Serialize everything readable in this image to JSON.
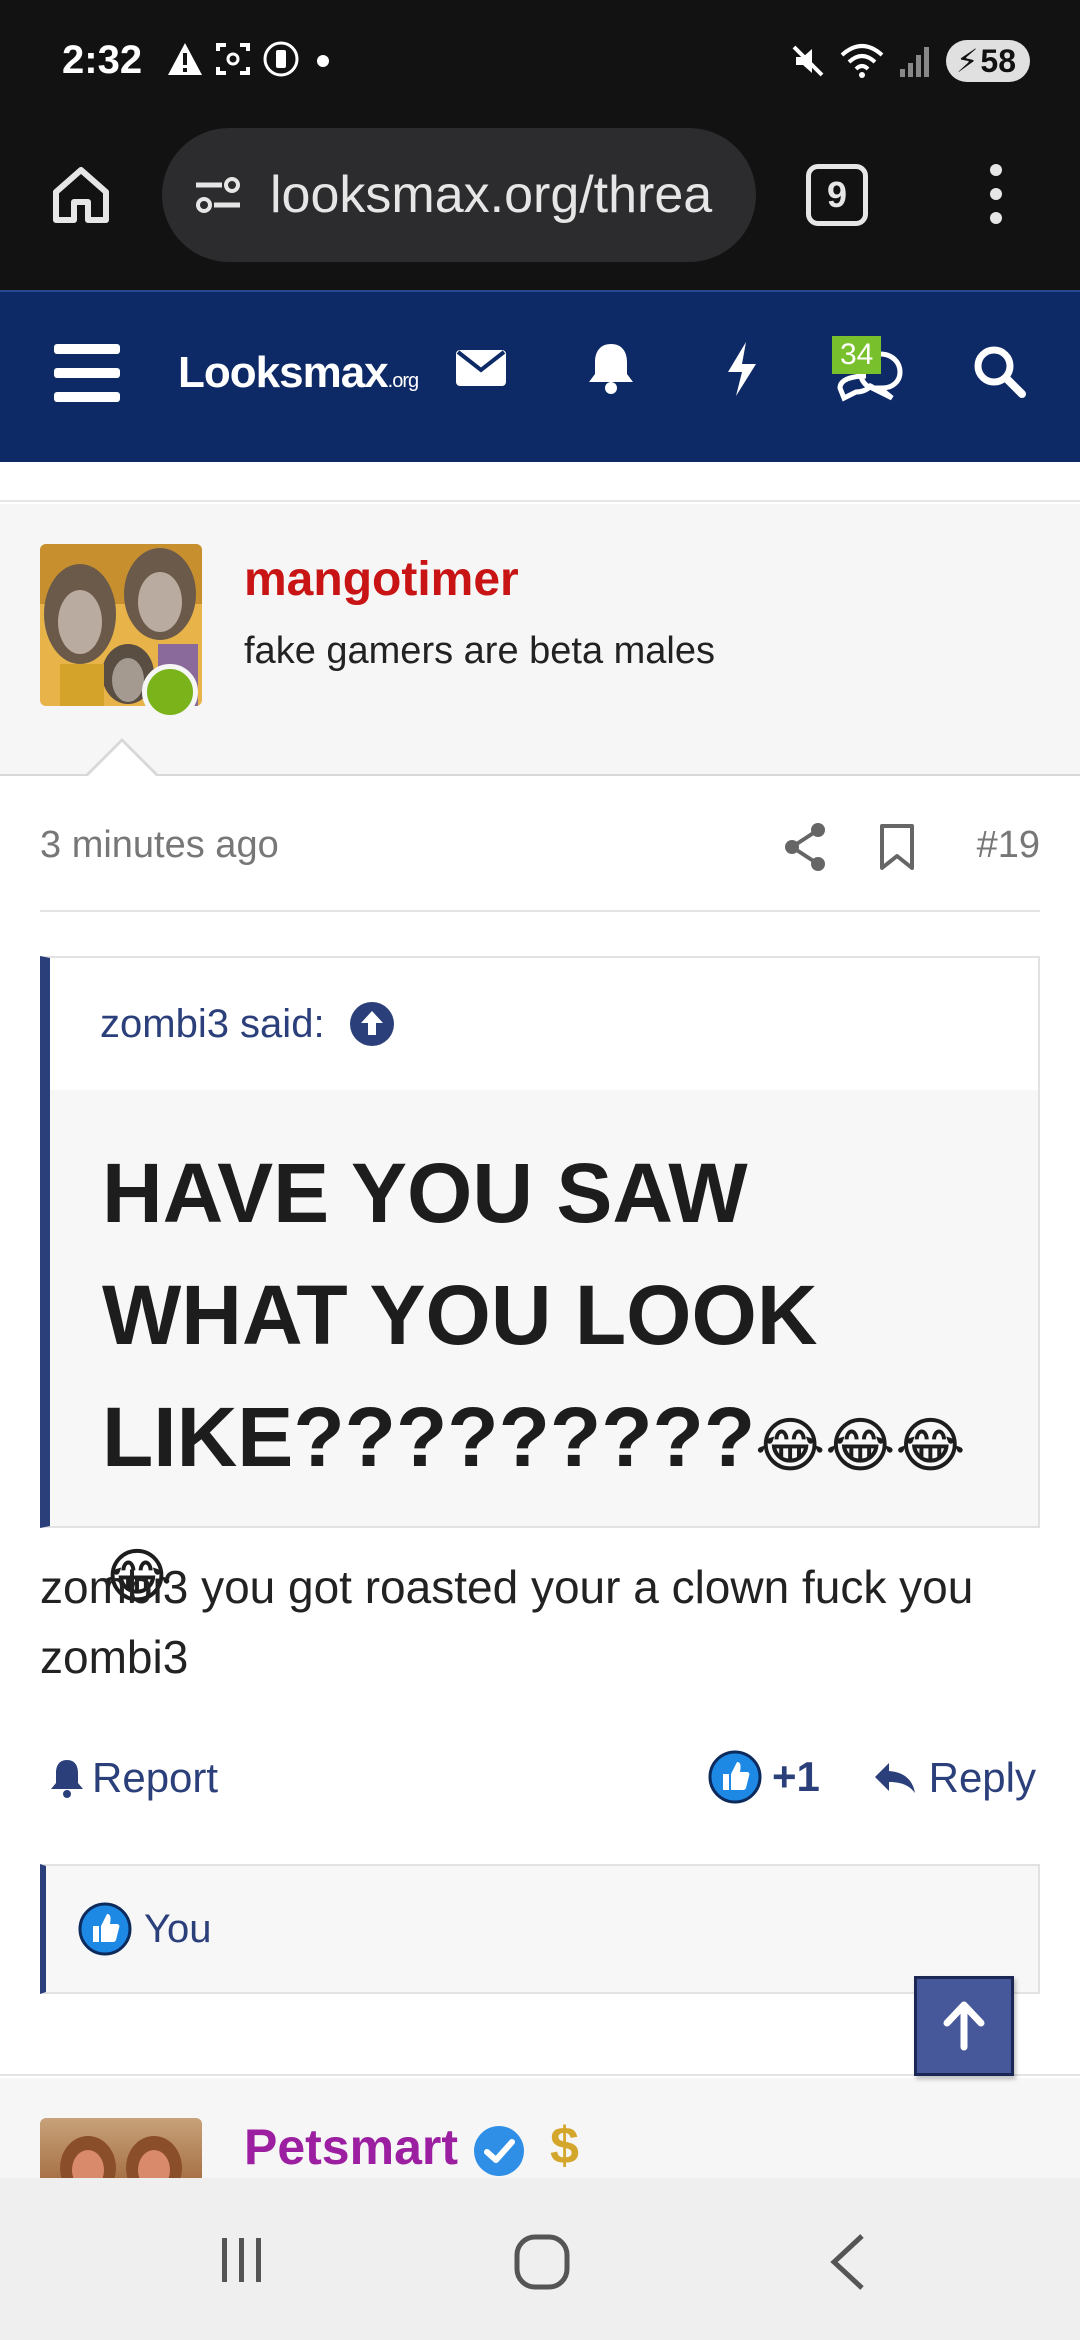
{
  "status_bar": {
    "time": "2:32",
    "battery": "58",
    "icons": [
      "warning-icon",
      "screenshot-icon",
      "vibrate-icon",
      "dot-icon",
      "mute-icon",
      "wifi-icon",
      "signal-icon",
      "battery-charging-icon"
    ]
  },
  "browser": {
    "url": "looksmax.org/threa",
    "tab_count": "9"
  },
  "site_nav": {
    "logo_main": "Looksmax",
    "logo_suffix": ".org",
    "chat_badge": "34"
  },
  "post": {
    "username": "mangotimer",
    "user_title": "fake gamers are beta males",
    "time_ago": "3 minutes ago",
    "post_number": "#19",
    "quote_author": "zombi3 said:",
    "quote_text": "HAVE YOU SAW WHAT YOU LOOK LIKE?????????",
    "quote_emojis": "😂😂😂😂",
    "body": "zombi3 you got roasted your a clown fuck you zombi3",
    "report_label": "Report",
    "like_count": "+1",
    "reply_label": "Reply",
    "liked_by": "You"
  },
  "next_post": {
    "username": "Petsmart",
    "badge_symbol": "$"
  },
  "colors": {
    "nav_bg": "#0e2a66",
    "username_red": "#c81414",
    "link_blue": "#2b3f7a",
    "online_green": "#7ab31a",
    "badge_green": "#78c02c",
    "petsmart_purple": "#9b1fa0"
  }
}
